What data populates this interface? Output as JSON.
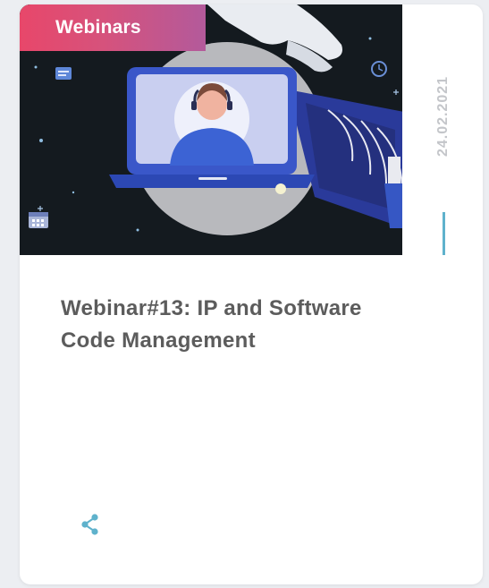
{
  "card": {
    "category": "Webinars",
    "date": "24.02.2021",
    "title": "Webinar#13: IP and Software Code Management",
    "share_icon": "share-icon",
    "image_icon": "webinar-illustration"
  },
  "colors": {
    "badge_start": "#e8476a",
    "badge_end": "#b35a9b",
    "accent": "#5fb2cc",
    "title_text": "#5c5c5c",
    "date_text": "#c4c6ca",
    "card_bg": "#ffffff",
    "page_bg": "#eceef2"
  }
}
